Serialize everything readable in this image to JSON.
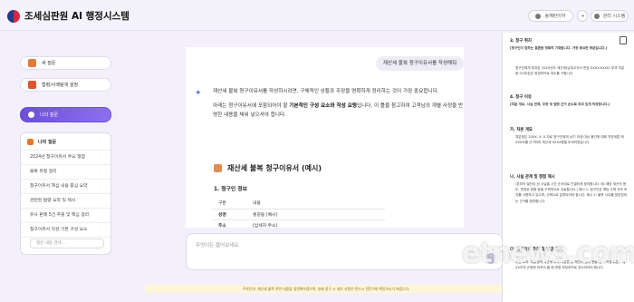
{
  "app": {
    "title": "조세심판원 AI 행정시스템"
  },
  "header": {
    "user_label": "송혜란이어",
    "admin_label": "관리 시스템"
  },
  "sidebar": {
    "new_question": "새 질문",
    "law_search": "법령/사례탐색 설정",
    "my_questions": "나의 질문",
    "panel_title": "나의 질문",
    "items": [
      "2024년 청구이유서 주요 쟁점",
      "불복 유형 정리",
      "청구이유서 핵심 내용 중심 요약",
      "관련된 법령 요약 및 제시",
      "유사 판례 5건 추출 및 핵심 정리",
      "청구이유서 작성 기본 구성 요소",
      "청구이유서 작성 기반"
    ],
    "search_placeholder": "질문 내용 검색..."
  },
  "chat": {
    "user_message": "재산세 불복 청구이유서를 작성해줘",
    "answer_p1": "재산세 불복 청구이유서를 작성하시려면, 구체적인 상황과 주장을 명확하게 정리하는 것이 가장 중요합니다.",
    "answer_p2_a": "아래는 청구이유서에 포함되어야 할 ",
    "answer_p2_b": "기본적인 구성 요소와 작성 요령",
    "answer_p2_c": "입니다. 이 틀을 참고하여 고객님의 개별 사정을 반영한 내용을 채워 넣으셔야 합니다.",
    "doc_title": "재산세 불복 청구이유서 (예시)",
    "section1": "1. 청구인 정보",
    "table": [
      {
        "k": "구분",
        "v": "내용"
      },
      {
        "k": "성명",
        "v": "홍길동 (예시)"
      },
      {
        "k": "주소",
        "v": "(납세자 주소)"
      }
    ]
  },
  "input": {
    "placeholder": "무엇이든 물어보세요."
  },
  "notice": "주의안내: 재산세 불복 관련 내용을 일반화하였으며, 실제 청구 시 세부 사항은 반드시 전문가와 확인하시기 바랍니다.",
  "doc_panel": {
    "sections": [
      {
        "h": "3. 청구 취지",
        "t": "[청구인이 원하는 결론을 명확히 기재합니다. 가장 중요한 부분입니다.]"
      },
      {
        "t": "청구인에게 부과된 20XX년도 재산세(납세고지서 번호 XXXX-XXXX) 부과 처분 중 OO부분은 위법하므로 취소를 구합니다."
      },
      {
        "h": "4. 청구 이유",
        "t": "[처분 개요, 사실 관계, 주장 및 법령 근거 순으로 조리 있게 작성합니다.]"
      },
      {
        "h": "가. 처분 개요",
        "t": "처분청은 20XX. X. X.자로 청구인에게 상기 과세 대상 물건에 대해 지방세법 제XXX조를 근거하여 재산세 XXXX원을 부과하였습니다."
      },
      {
        "h": "나. 사실 관계 및 쟁점 제시",
        "t": "(본처의 발단이 된 사실을 시간 순서대로 간결하게 정리합니다. 예: 해당 재산의 용도, 변경된 현황 등을 구체적으로 서술합니다.) 예시 1: 청구인은 해당 주택 부속 토지를 사용하고 있으며, 주택으로 분류되어야 합니다. 예시 2: 불복 사유를 뒷받침하는 근거를 첨부합니다."
      },
      {
        "h": "다. 청구인의 주장 및 법령 근거",
        "t": "주장 요지: 처분청의 재산세 부과 처분은 본 재산의 실제 현황 및 「지방세법」 제XX조의 규정에 비추어 볼 때 위법·부당하므로 취소되어야 합니다."
      }
    ]
  },
  "watermark": "etnews.com"
}
